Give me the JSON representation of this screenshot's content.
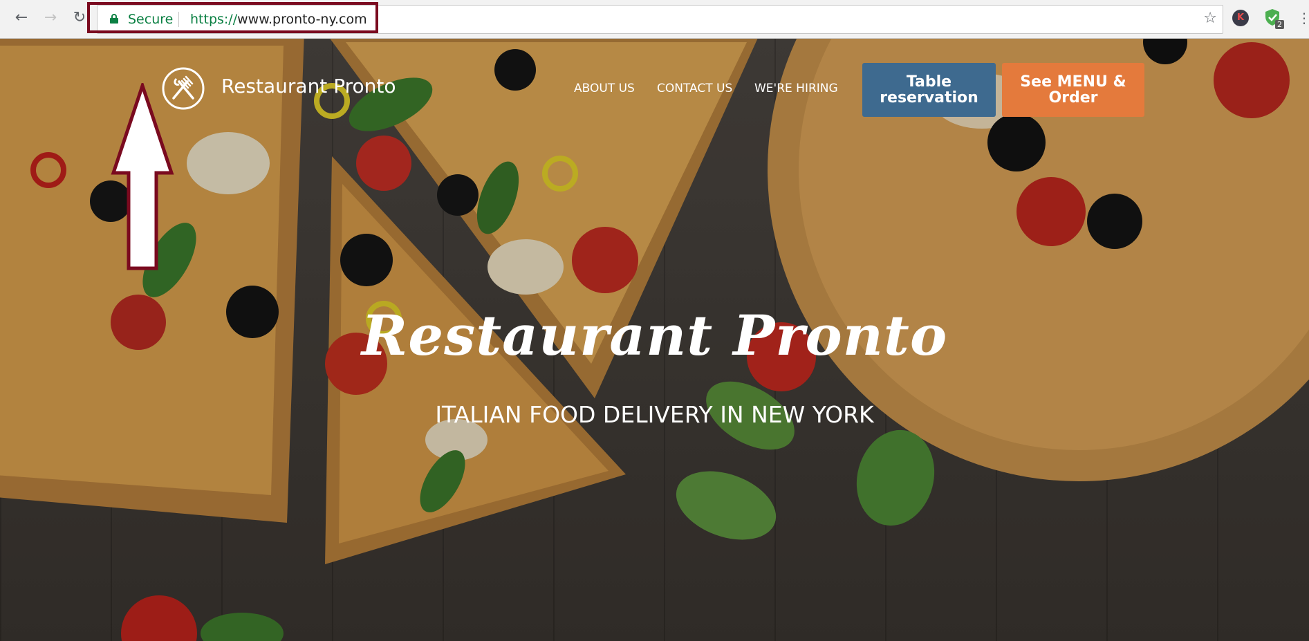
{
  "browser": {
    "security_label": "Secure",
    "url_scheme": "https://",
    "url_host": "www.pronto-ny.com",
    "extension_badge_count": "2",
    "extension_k_label": "K"
  },
  "site": {
    "brand": "Restaurant Pronto",
    "nav": [
      "ABOUT US",
      "CONTACT US",
      "WE'RE HIRING"
    ],
    "buttons": {
      "reservation": [
        "Table",
        "reservation"
      ],
      "menu": [
        "See MENU &",
        "Order"
      ]
    },
    "hero_title": "Restaurant Pronto",
    "hero_subtitle": "ITALIAN FOOD DELIVERY IN NEW YORK"
  },
  "colors": {
    "secure_green": "#0b8043",
    "highlight_border": "#7a0a1f",
    "reservation_button": "#3e6a8f",
    "menu_button": "#e47a3c"
  },
  "icons": [
    "back-icon",
    "forward-icon",
    "reload-icon",
    "lock-icon",
    "star-icon",
    "kebab-menu-icon",
    "restaurant-logo-icon",
    "annotation-arrow"
  ]
}
